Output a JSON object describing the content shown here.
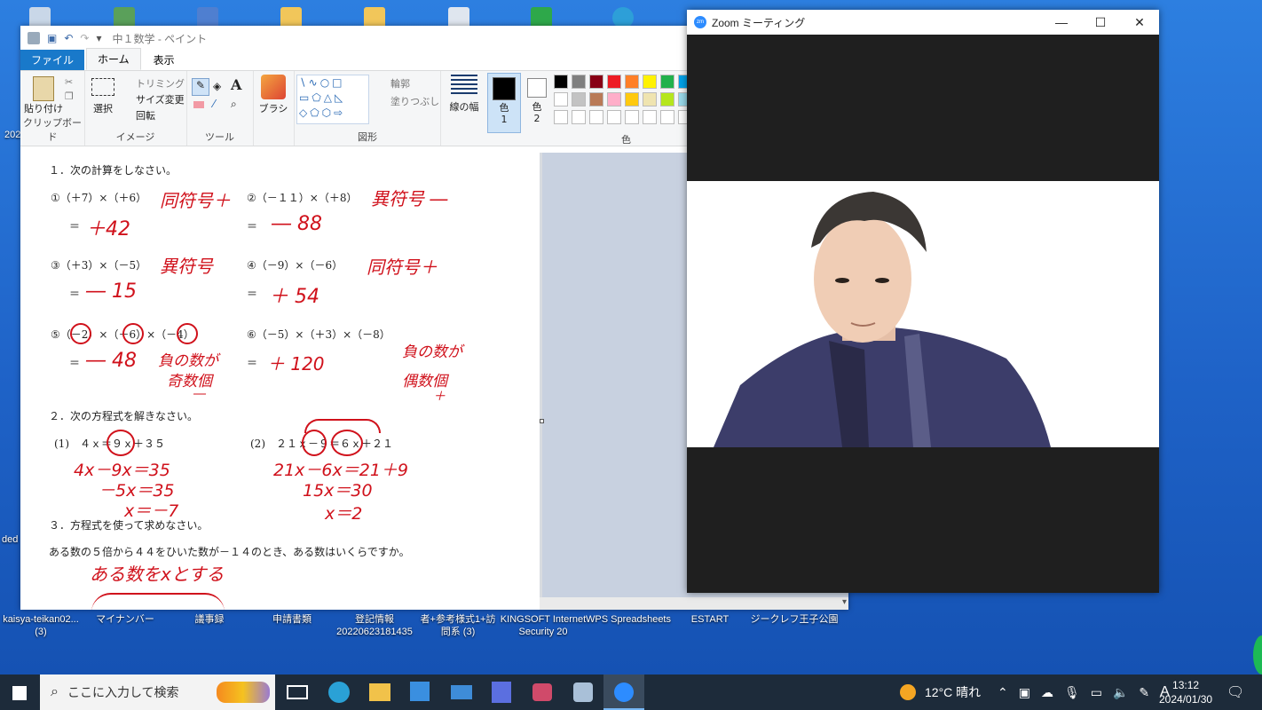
{
  "paint": {
    "title": "中１数学 - ペイント",
    "tabs": [
      "ファイル",
      "ホーム",
      "表示"
    ],
    "clipboard": {
      "paste": "貼り付け",
      "group": "クリップボード"
    },
    "image": {
      "select": "選択",
      "trim": "トリミング",
      "resize": "サイズ変更",
      "rotate": "回転",
      "group": "イメージ"
    },
    "tools_group": "ツール",
    "brush": "ブラシ",
    "shapes": {
      "outline": "輪郭",
      "fill": "塗りつぶし",
      "group": "図形"
    },
    "line_width": "線の幅",
    "color1": "色\n1",
    "color2": "色\n2",
    "colors_group": "色",
    "palette": [
      "#000000",
      "#7f7f7f",
      "#880015",
      "#ed1c24",
      "#ff7f27",
      "#fff200",
      "#22b14c",
      "#00a2e8"
    ],
    "palette2": [
      "#ffffff",
      "#c3c3c3",
      "#b97a57",
      "#ffaec9",
      "#ffc90e",
      "#efe4b0",
      "#b5e61d",
      "#99d9ea"
    ]
  },
  "worksheet": {
    "q1": "１．次の計算をしなさい。",
    "p1": "①（＋7）×（＋6）",
    "p2": "②（－１１）×（＋8）",
    "p3": "③（＋3）×（－5）",
    "p4": "④（－9）×（－6）",
    "p5": "⑤（－2）×（－6）×（－4）",
    "p6": "⑥（－5）×（＋3）×（－8）",
    "q2": "２．次の方程式を解きなさい。",
    "e1": "(1)　４ｘ＝９ｘ＋３５",
    "e2": "(2)　２１ｘ－９＝６ｘ＋２１",
    "q3": "３．方程式を使って求めなさい。",
    "q3text": "ある数の５倍から４４をひいた数が－１４のとき、ある数はいくらですか。",
    "eq": "＝"
  },
  "handwriting": {
    "h1": "同符号＋",
    "a1": "＋42",
    "h2": "異符号 ―",
    "a2": "― 88",
    "h3": "異符号",
    "a3": "― 15",
    "h4": "同符号＋",
    "a4": "＋ 54",
    "a5": "― 48",
    "h5a": "負の数が",
    "h5b": "奇数個",
    "h5c": "―",
    "a6": "＋ 120",
    "h6a": "負の数が",
    "h6b": "偶数個",
    "h6c": "＋",
    "s1a": "4x－9x＝35",
    "s1b": "－5x＝35",
    "s1c": "x＝－7",
    "s2a": "21x－6x＝21＋9",
    "s2b": "15x＝30",
    "s2c": "x＝2",
    "s3": "ある数をxとする"
  },
  "zoom": {
    "title": "Zoom ミーティング"
  },
  "desktop": {
    "labels": [
      "kaisya-teikan02...\n(3)",
      "マイナンバー",
      "議事録",
      "申請書類",
      "登記情報\n20220623181435",
      "者+参考様式1+訪\n問系 (3)",
      "KINGSOFT Internet\nSecurity 20",
      "WPS Spreadsheets",
      "ESTART",
      "ジークレフ王子公園"
    ],
    "left_partial_1": "202",
    "left_partial_2": "ded"
  },
  "taskbar": {
    "search_placeholder": "ここに入力して検索",
    "weather": "12°C 晴れ",
    "ime": "A",
    "time": "13:12",
    "date": "2024/01/30"
  }
}
